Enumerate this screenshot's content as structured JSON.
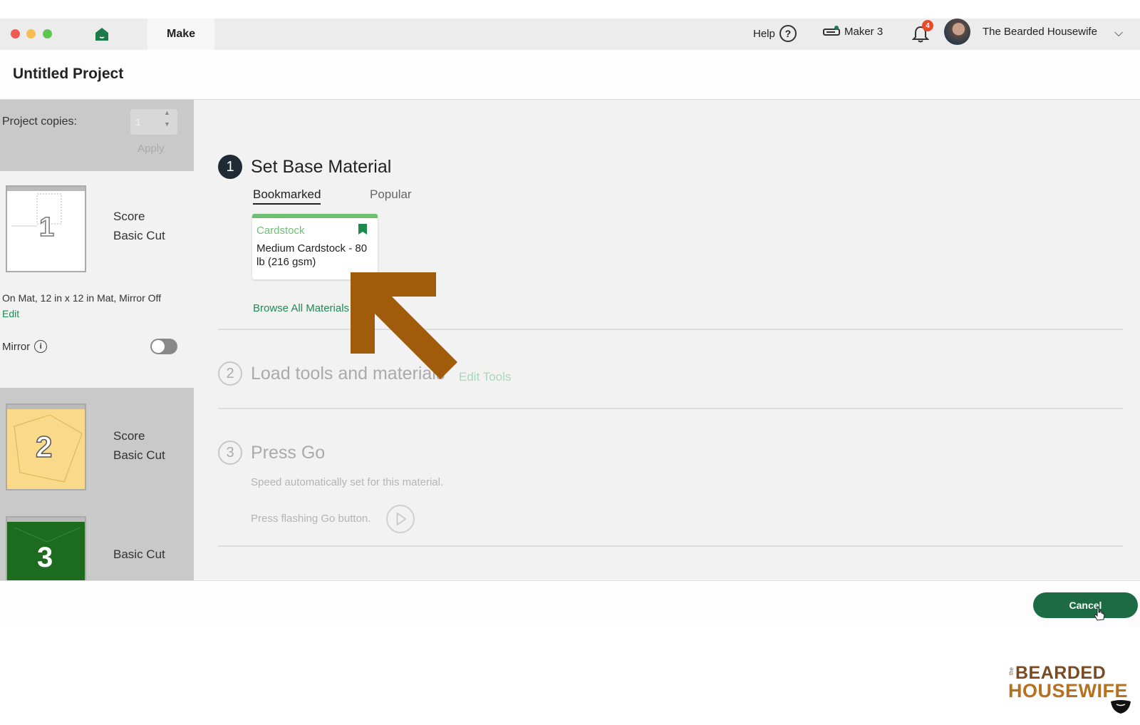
{
  "topbar": {
    "make_tab": "Make",
    "help_label": "Help",
    "help_icon": "?",
    "machine_label": "Maker 3",
    "notification_count": "4",
    "user_name": "The Bearded Housewife",
    "chevron": "⌵"
  },
  "project": {
    "title": "Untitled Project"
  },
  "sidebar": {
    "copies_label": "Project copies:",
    "copies_value": "1",
    "apply_label": "Apply",
    "mats": [
      {
        "number": "1",
        "operations": [
          "Score",
          "Basic Cut"
        ]
      },
      {
        "number": "2",
        "operations": [
          "Score",
          "Basic Cut"
        ]
      },
      {
        "number": "3",
        "operations": [
          "Basic Cut"
        ]
      }
    ],
    "mat_info": "On Mat, 12 in x 12 in Mat, Mirror Off",
    "edit_label": "Edit",
    "mirror_label": "Mirror",
    "mirror_on": false
  },
  "steps": {
    "step1": {
      "number": "1",
      "title": "Set Base Material"
    },
    "tabs": {
      "bookmarked": "Bookmarked",
      "popular": "Popular"
    },
    "material": {
      "category": "Cardstock",
      "name": "Medium Cardstock - 80 lb (216 gsm)"
    },
    "browse_label": "Browse All Materials",
    "step2": {
      "number": "2",
      "title": "Load tools and materials",
      "edit_tools": "Edit Tools"
    },
    "step3": {
      "number": "3",
      "title": "Press Go",
      "speed_text": "Speed automatically set for this material.",
      "press_text": "Press flashing Go button."
    }
  },
  "footer": {
    "cancel_label": "Cancel"
  },
  "logo": {
    "the": "the",
    "line1": "BEARDED",
    "line2": "HOUSEWIFE"
  },
  "colors": {
    "accent_green": "#1d6b45",
    "material_green": "#6dc071",
    "arrow_brown": "#a05c0a"
  }
}
